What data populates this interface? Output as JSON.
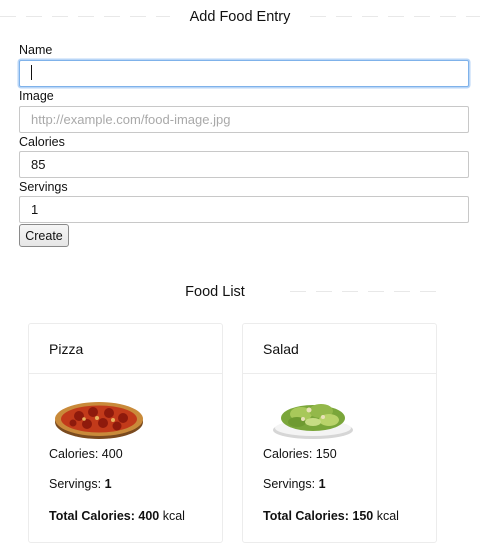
{
  "form": {
    "heading": "Add Food Entry",
    "name_label": "Name",
    "name_value": "",
    "image_label": "Image",
    "image_placeholder": "http://example.com/food-image.jpg",
    "calories_label": "Calories",
    "calories_value": "85",
    "servings_label": "Servings",
    "servings_value": "1",
    "create_label": "Create"
  },
  "list": {
    "heading": "Food List",
    "items": [
      {
        "name": "Pizza",
        "image_icon": "pizza-image",
        "calories_text": "Calories: 400",
        "servings_label": "Servings:",
        "servings_value": "1",
        "total_label": "Total Calories:",
        "total_value": "400",
        "total_unit": "kcal"
      },
      {
        "name": "Salad",
        "image_icon": "salad-image",
        "calories_text": "Calories: 150",
        "servings_label": "Servings:",
        "servings_value": "1",
        "total_label": "Total Calories:",
        "total_value": "150",
        "total_unit": "kcal"
      }
    ]
  }
}
